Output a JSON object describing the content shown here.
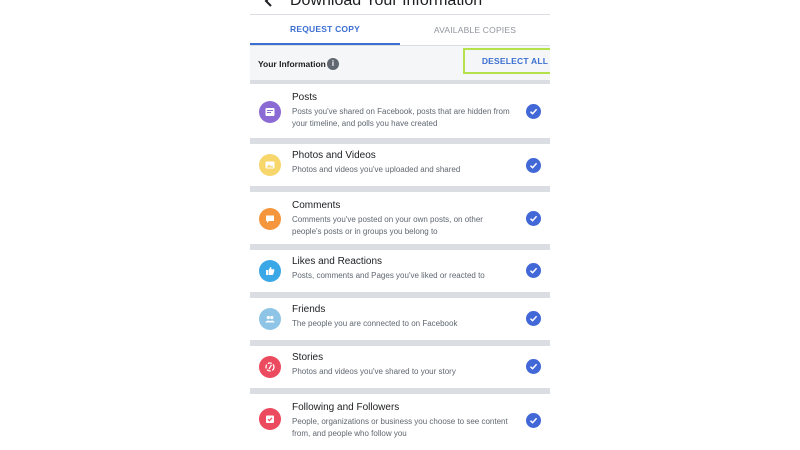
{
  "header": {
    "title": "Download Your Information"
  },
  "tabs": [
    {
      "label": "REQUEST COPY",
      "active": true
    },
    {
      "label": "AVAILABLE COPIES",
      "active": false
    }
  ],
  "info_row": {
    "label": "Your Information",
    "info_icon_glyph": "i",
    "deselect_label": "DESELECT ALL"
  },
  "items": [
    {
      "title": "Posts",
      "description": "Posts you've shared on Facebook, posts that are hidden from your timeline, and polls you have created",
      "icon": "posts-icon",
      "icon_color": "#8c6ad4",
      "checked": true
    },
    {
      "title": "Photos and Videos",
      "description": "Photos and videos you've uploaded and shared",
      "icon": "photos-icon",
      "icon_color": "#f7d66b",
      "checked": true
    },
    {
      "title": "Comments",
      "description": "Comments you've posted on your own posts, on other people's posts or in groups you belong to",
      "icon": "comments-icon",
      "icon_color": "#f5953c",
      "checked": true
    },
    {
      "title": "Likes and Reactions",
      "description": "Posts, comments and Pages you've liked or reacted to",
      "icon": "like-icon",
      "icon_color": "#3aa7e6",
      "checked": true
    },
    {
      "title": "Friends",
      "description": "The people you are connected to on Facebook",
      "icon": "friends-icon",
      "icon_color": "#8ec5e6",
      "checked": true
    },
    {
      "title": "Stories",
      "description": "Photos and videos you've shared to your story",
      "icon": "stories-icon",
      "icon_color": "#ec4a5e",
      "checked": true
    },
    {
      "title": "Following and Followers",
      "description": "People, organizations or business you choose to see content from, and people who follow you",
      "icon": "following-icon",
      "icon_color": "#ec4a5e",
      "checked": true
    }
  ],
  "colors": {
    "accent": "#3b6fd1",
    "check": "#4267d6",
    "highlight_border": "#b5e24a",
    "separator": "#dadde1"
  }
}
